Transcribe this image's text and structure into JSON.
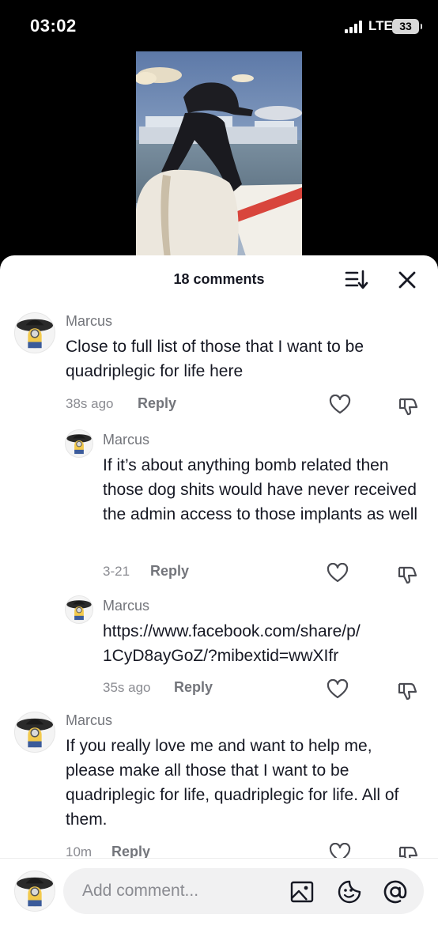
{
  "status_bar": {
    "time": "03:02",
    "network": "LTE",
    "battery": "33"
  },
  "sheet": {
    "comment_count": "18 comments"
  },
  "comments": [
    {
      "author": "Marcus",
      "text": "Close to full list of those that I want to be quadriplegic for life here",
      "time": "38s ago",
      "reply": "Reply",
      "is_reply": false
    },
    {
      "author": "Marcus",
      "text": "If it’s about anything bomb related then those dog shits would have never received the admin access to those implants as well",
      "time": "3-21",
      "reply": "Reply",
      "is_reply": true
    },
    {
      "author": "Marcus",
      "text": "https://www.facebook.com/share/p/\n1CyD8ayGoZ/?mibextid=wwXIfr",
      "time": "35s ago",
      "reply": "Reply",
      "is_reply": true
    },
    {
      "author": "Marcus",
      "text": "If you really love me and want to help me, please make all those that I want to be quadriplegic for life, quadriplegic for life. All of them.",
      "time": "10m",
      "reply": "Reply",
      "is_reply": false
    }
  ],
  "input": {
    "placeholder": "Add comment..."
  },
  "icons": {
    "sort": "sort-icon",
    "close": "close-icon",
    "like": "heart-icon",
    "dislike": "thumbs-down-icon",
    "image": "image-icon",
    "emoji": "emoji-icon",
    "mention": "at-mention-icon"
  }
}
